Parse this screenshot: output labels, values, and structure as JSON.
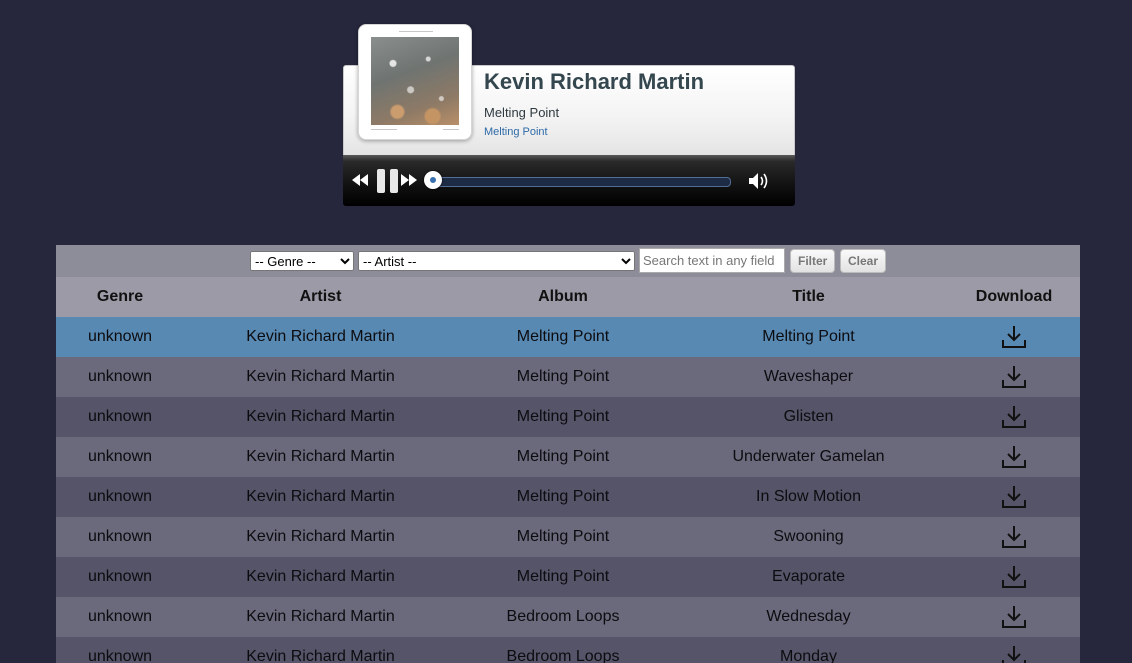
{
  "player": {
    "now_playing_artist": "Kevin Richard Martin",
    "now_playing_title": "Melting Point",
    "now_playing_album": "Melting Point",
    "progress_fraction": 0.0
  },
  "filters": {
    "genre_selected": "-- Genre --",
    "artist_selected": "-- Artist --",
    "search_placeholder": "Search text in any field",
    "filter_label": "Filter",
    "clear_label": "Clear"
  },
  "table": {
    "headers": [
      "Genre",
      "Artist",
      "Album",
      "Title",
      "Download"
    ],
    "rows": [
      {
        "genre": "unknown",
        "artist": "Kevin Richard Martin",
        "album": "Melting Point",
        "title": "Melting Point"
      },
      {
        "genre": "unknown",
        "artist": "Kevin Richard Martin",
        "album": "Melting Point",
        "title": "Waveshaper"
      },
      {
        "genre": "unknown",
        "artist": "Kevin Richard Martin",
        "album": "Melting Point",
        "title": "Glisten"
      },
      {
        "genre": "unknown",
        "artist": "Kevin Richard Martin",
        "album": "Melting Point",
        "title": "Underwater Gamelan"
      },
      {
        "genre": "unknown",
        "artist": "Kevin Richard Martin",
        "album": "Melting Point",
        "title": "In Slow Motion"
      },
      {
        "genre": "unknown",
        "artist": "Kevin Richard Martin",
        "album": "Melting Point",
        "title": "Swooning"
      },
      {
        "genre": "unknown",
        "artist": "Kevin Richard Martin",
        "album": "Melting Point",
        "title": "Evaporate"
      },
      {
        "genre": "unknown",
        "artist": "Kevin Richard Martin",
        "album": "Bedroom Loops",
        "title": "Wednesday"
      },
      {
        "genre": "unknown",
        "artist": "Kevin Richard Martin",
        "album": "Bedroom Loops",
        "title": "Monday"
      }
    ]
  },
  "colors": {
    "background": "#26263d",
    "row_active": "#5889b3",
    "row_odd": "#6b6a7c",
    "row_even": "#555468",
    "header": "#9b9aa6"
  },
  "icons": {
    "download": "download-icon",
    "rewind": "rewind-icon",
    "pause": "pause-icon",
    "fast_forward": "fast-forward-icon",
    "volume": "volume-icon"
  }
}
